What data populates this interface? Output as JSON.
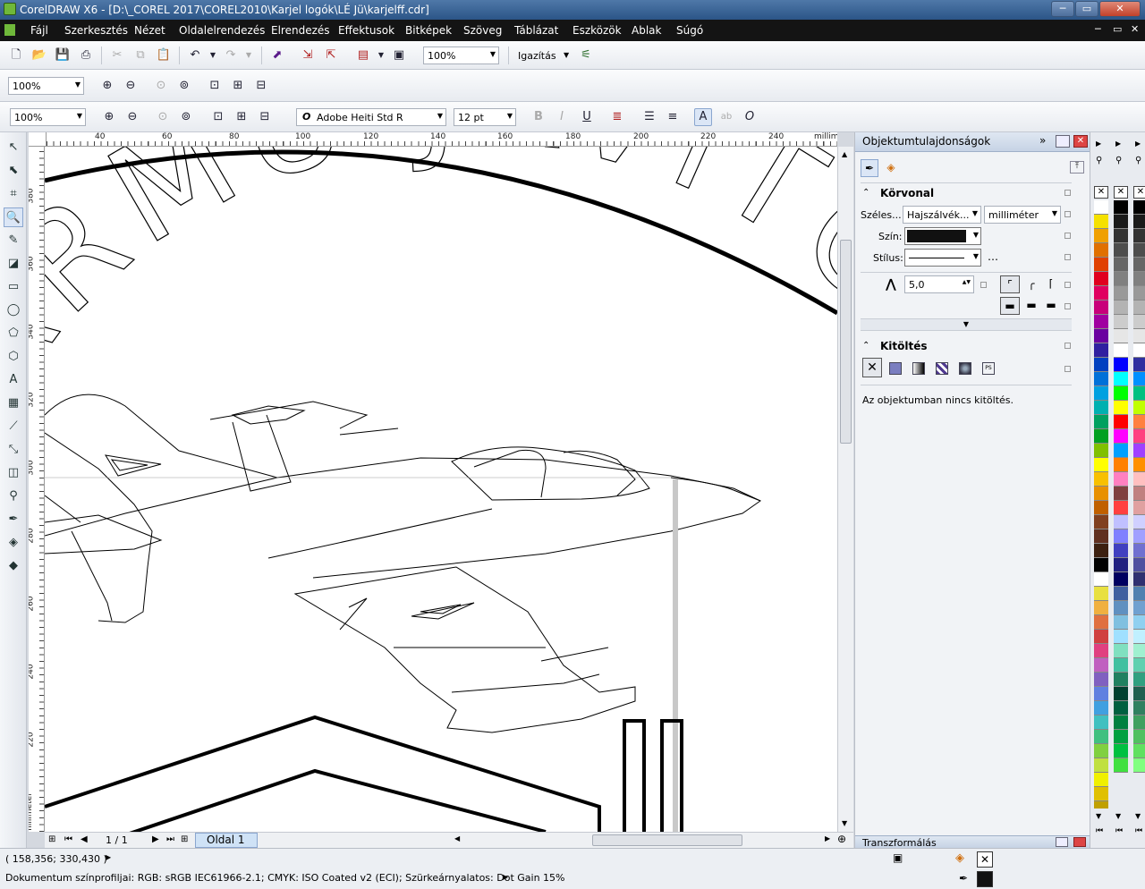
{
  "title": "CorelDRAW X6 - [D:\\_COREL 2017\\COREL2010\\Karjel logók\\LÉ Jü\\karjelff.cdr]",
  "window_buttons": [
    "─",
    "▭",
    "✕"
  ],
  "menu": [
    "Fájl",
    "Szerkesztés",
    "Nézet",
    "Oldalelrendezés",
    "Elrendezés",
    "Effektusok",
    "Bitképek",
    "Szöveg",
    "Táblázat",
    "Eszközök",
    "Ablak",
    "Súgó"
  ],
  "toolbar1": {
    "zoom": "100%",
    "snap_label": "Igazítás"
  },
  "toolbar2": {
    "zoom": "100%"
  },
  "toolbar3": {
    "zoom": "100%",
    "font": "Adobe Heiti Std R",
    "size": "12 pt"
  },
  "ruler_unit": "milliméter",
  "ruler_top": [
    "40",
    "60",
    "80",
    "100",
    "120",
    "140",
    "160",
    "180",
    "200",
    "220",
    "240"
  ],
  "ruler_left": [
    "380",
    "360",
    "340",
    "320",
    "300",
    "280",
    "260",
    "240",
    "220"
  ],
  "canvas_text": {
    "arc_text": "ARMŰ JAVÍTÓ"
  },
  "page_nav": {
    "counter": "1 / 1",
    "tab": "Oldal 1"
  },
  "docker": {
    "title": "Objektumtulajdonságok",
    "outline_section": "Körvonal",
    "width_label": "Széles...",
    "width_value": "Hajszálvék...",
    "unit_value": "milliméter",
    "color_label": "Szín:",
    "style_label": "Stílus:",
    "miter_value": "5,0",
    "fill_section": "Kitöltés",
    "fill_message": "Az objektumban nincs kitöltés.",
    "bottom_title": "Transzformálás"
  },
  "palette_colors": {
    "col1": [
      "#ffffff",
      "#f5e100",
      "#f0a000",
      "#e07000",
      "#e04000",
      "#e0001e",
      "#e00060",
      "#c8007a",
      "#a000a0",
      "#6a00a0",
      "#3020a0",
      "#0040c0",
      "#0070d8",
      "#00a0e0",
      "#00b0b0",
      "#00a060",
      "#00a020",
      "#80c000",
      "#ffff00",
      "#f8c000",
      "#e89000",
      "#c06000",
      "#804020",
      "#603020",
      "#3c2010",
      "#000000",
      "#ffffff",
      "#e8e040",
      "#f0b040",
      "#e07040",
      "#d04040",
      "#e04080",
      "#c060c0",
      "#8060c0",
      "#6080e0",
      "#40a0e0",
      "#40c0c0",
      "#40c080",
      "#80d040",
      "#c0e040",
      "#f0f000",
      "#e0c000",
      "#c0a000",
      "#a08000",
      "#808000",
      "#606000",
      "#404000",
      "#202000",
      "#ffff80",
      "#f0f0a0",
      "#e0e0c0"
    ],
    "col2": [
      "#000000",
      "#1a1a1a",
      "#333333",
      "#4d4d4d",
      "#666666",
      "#808080",
      "#999999",
      "#b3b3b3",
      "#cccccc",
      "#e6e6e6",
      "#ffffff",
      "#0000ff",
      "#00ffff",
      "#00ff00",
      "#ffff00",
      "#ff0000",
      "#ff00ff",
      "#00a0ff",
      "#ff8000",
      "#ff80c0",
      "#804040",
      "#ff4040",
      "#c0c0ff",
      "#8080ff",
      "#4040c0",
      "#202080",
      "#000060",
      "#4060a0",
      "#6090c0",
      "#80c0e0",
      "#a0e0ff",
      "#80e0c0",
      "#40c0a0",
      "#208060",
      "#004030",
      "#006040",
      "#008040",
      "#00a040",
      "#00c040",
      "#40e040"
    ],
    "col3": [
      "#000000",
      "#1a1a1a",
      "#333333",
      "#4d4d4d",
      "#666666",
      "#808080",
      "#999999",
      "#b3b3b3",
      "#cccccc",
      "#e6e6e6",
      "#ffffff",
      "#3030a0",
      "#0090ff",
      "#00c080",
      "#c0ff00",
      "#ff8040",
      "#ff4080",
      "#a040ff",
      "#ff9000",
      "#ffc0c0",
      "#c08080",
      "#e0a0a0",
      "#d0d0ff",
      "#a0a0ff",
      "#7070d0",
      "#5050a0",
      "#303070",
      "#5080b0",
      "#70a0d0",
      "#90d0f0",
      "#c0f0ff",
      "#a0f0d0",
      "#60d0b0",
      "#30a080",
      "#206050",
      "#308060",
      "#40a060",
      "#50c060",
      "#60e060",
      "#80ff80"
    ]
  },
  "status": {
    "coords": "( 158,356; 330,430 )",
    "profile": "Dokumentum színprofiljai: RGB: sRGB IEC61966-2.1; CMYK: ISO Coated v2 (ECI); Szürkeárnyalatos: Dot Gain 15%"
  }
}
